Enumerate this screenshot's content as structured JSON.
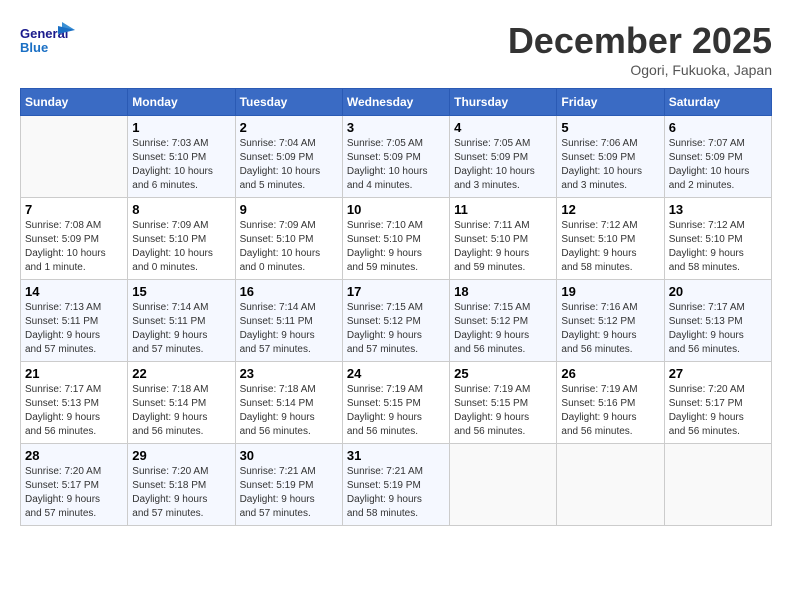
{
  "header": {
    "logo_text1": "General",
    "logo_text2": "Blue",
    "month_title": "December 2025",
    "subtitle": "Ogori, Fukuoka, Japan"
  },
  "weekdays": [
    "Sunday",
    "Monday",
    "Tuesday",
    "Wednesday",
    "Thursday",
    "Friday",
    "Saturday"
  ],
  "weeks": [
    [
      {
        "day": "",
        "info": ""
      },
      {
        "day": "1",
        "info": "Sunrise: 7:03 AM\nSunset: 5:10 PM\nDaylight: 10 hours\nand 6 minutes."
      },
      {
        "day": "2",
        "info": "Sunrise: 7:04 AM\nSunset: 5:09 PM\nDaylight: 10 hours\nand 5 minutes."
      },
      {
        "day": "3",
        "info": "Sunrise: 7:05 AM\nSunset: 5:09 PM\nDaylight: 10 hours\nand 4 minutes."
      },
      {
        "day": "4",
        "info": "Sunrise: 7:05 AM\nSunset: 5:09 PM\nDaylight: 10 hours\nand 3 minutes."
      },
      {
        "day": "5",
        "info": "Sunrise: 7:06 AM\nSunset: 5:09 PM\nDaylight: 10 hours\nand 3 minutes."
      },
      {
        "day": "6",
        "info": "Sunrise: 7:07 AM\nSunset: 5:09 PM\nDaylight: 10 hours\nand 2 minutes."
      }
    ],
    [
      {
        "day": "7",
        "info": "Sunrise: 7:08 AM\nSunset: 5:09 PM\nDaylight: 10 hours\nand 1 minute."
      },
      {
        "day": "8",
        "info": "Sunrise: 7:09 AM\nSunset: 5:10 PM\nDaylight: 10 hours\nand 0 minutes."
      },
      {
        "day": "9",
        "info": "Sunrise: 7:09 AM\nSunset: 5:10 PM\nDaylight: 10 hours\nand 0 minutes."
      },
      {
        "day": "10",
        "info": "Sunrise: 7:10 AM\nSunset: 5:10 PM\nDaylight: 9 hours\nand 59 minutes."
      },
      {
        "day": "11",
        "info": "Sunrise: 7:11 AM\nSunset: 5:10 PM\nDaylight: 9 hours\nand 59 minutes."
      },
      {
        "day": "12",
        "info": "Sunrise: 7:12 AM\nSunset: 5:10 PM\nDaylight: 9 hours\nand 58 minutes."
      },
      {
        "day": "13",
        "info": "Sunrise: 7:12 AM\nSunset: 5:10 PM\nDaylight: 9 hours\nand 58 minutes."
      }
    ],
    [
      {
        "day": "14",
        "info": "Sunrise: 7:13 AM\nSunset: 5:11 PM\nDaylight: 9 hours\nand 57 minutes."
      },
      {
        "day": "15",
        "info": "Sunrise: 7:14 AM\nSunset: 5:11 PM\nDaylight: 9 hours\nand 57 minutes."
      },
      {
        "day": "16",
        "info": "Sunrise: 7:14 AM\nSunset: 5:11 PM\nDaylight: 9 hours\nand 57 minutes."
      },
      {
        "day": "17",
        "info": "Sunrise: 7:15 AM\nSunset: 5:12 PM\nDaylight: 9 hours\nand 57 minutes."
      },
      {
        "day": "18",
        "info": "Sunrise: 7:15 AM\nSunset: 5:12 PM\nDaylight: 9 hours\nand 56 minutes."
      },
      {
        "day": "19",
        "info": "Sunrise: 7:16 AM\nSunset: 5:12 PM\nDaylight: 9 hours\nand 56 minutes."
      },
      {
        "day": "20",
        "info": "Sunrise: 7:17 AM\nSunset: 5:13 PM\nDaylight: 9 hours\nand 56 minutes."
      }
    ],
    [
      {
        "day": "21",
        "info": "Sunrise: 7:17 AM\nSunset: 5:13 PM\nDaylight: 9 hours\nand 56 minutes."
      },
      {
        "day": "22",
        "info": "Sunrise: 7:18 AM\nSunset: 5:14 PM\nDaylight: 9 hours\nand 56 minutes."
      },
      {
        "day": "23",
        "info": "Sunrise: 7:18 AM\nSunset: 5:14 PM\nDaylight: 9 hours\nand 56 minutes."
      },
      {
        "day": "24",
        "info": "Sunrise: 7:19 AM\nSunset: 5:15 PM\nDaylight: 9 hours\nand 56 minutes."
      },
      {
        "day": "25",
        "info": "Sunrise: 7:19 AM\nSunset: 5:15 PM\nDaylight: 9 hours\nand 56 minutes."
      },
      {
        "day": "26",
        "info": "Sunrise: 7:19 AM\nSunset: 5:16 PM\nDaylight: 9 hours\nand 56 minutes."
      },
      {
        "day": "27",
        "info": "Sunrise: 7:20 AM\nSunset: 5:17 PM\nDaylight: 9 hours\nand 56 minutes."
      }
    ],
    [
      {
        "day": "28",
        "info": "Sunrise: 7:20 AM\nSunset: 5:17 PM\nDaylight: 9 hours\nand 57 minutes."
      },
      {
        "day": "29",
        "info": "Sunrise: 7:20 AM\nSunset: 5:18 PM\nDaylight: 9 hours\nand 57 minutes."
      },
      {
        "day": "30",
        "info": "Sunrise: 7:21 AM\nSunset: 5:19 PM\nDaylight: 9 hours\nand 57 minutes."
      },
      {
        "day": "31",
        "info": "Sunrise: 7:21 AM\nSunset: 5:19 PM\nDaylight: 9 hours\nand 58 minutes."
      },
      {
        "day": "",
        "info": ""
      },
      {
        "day": "",
        "info": ""
      },
      {
        "day": "",
        "info": ""
      }
    ]
  ]
}
